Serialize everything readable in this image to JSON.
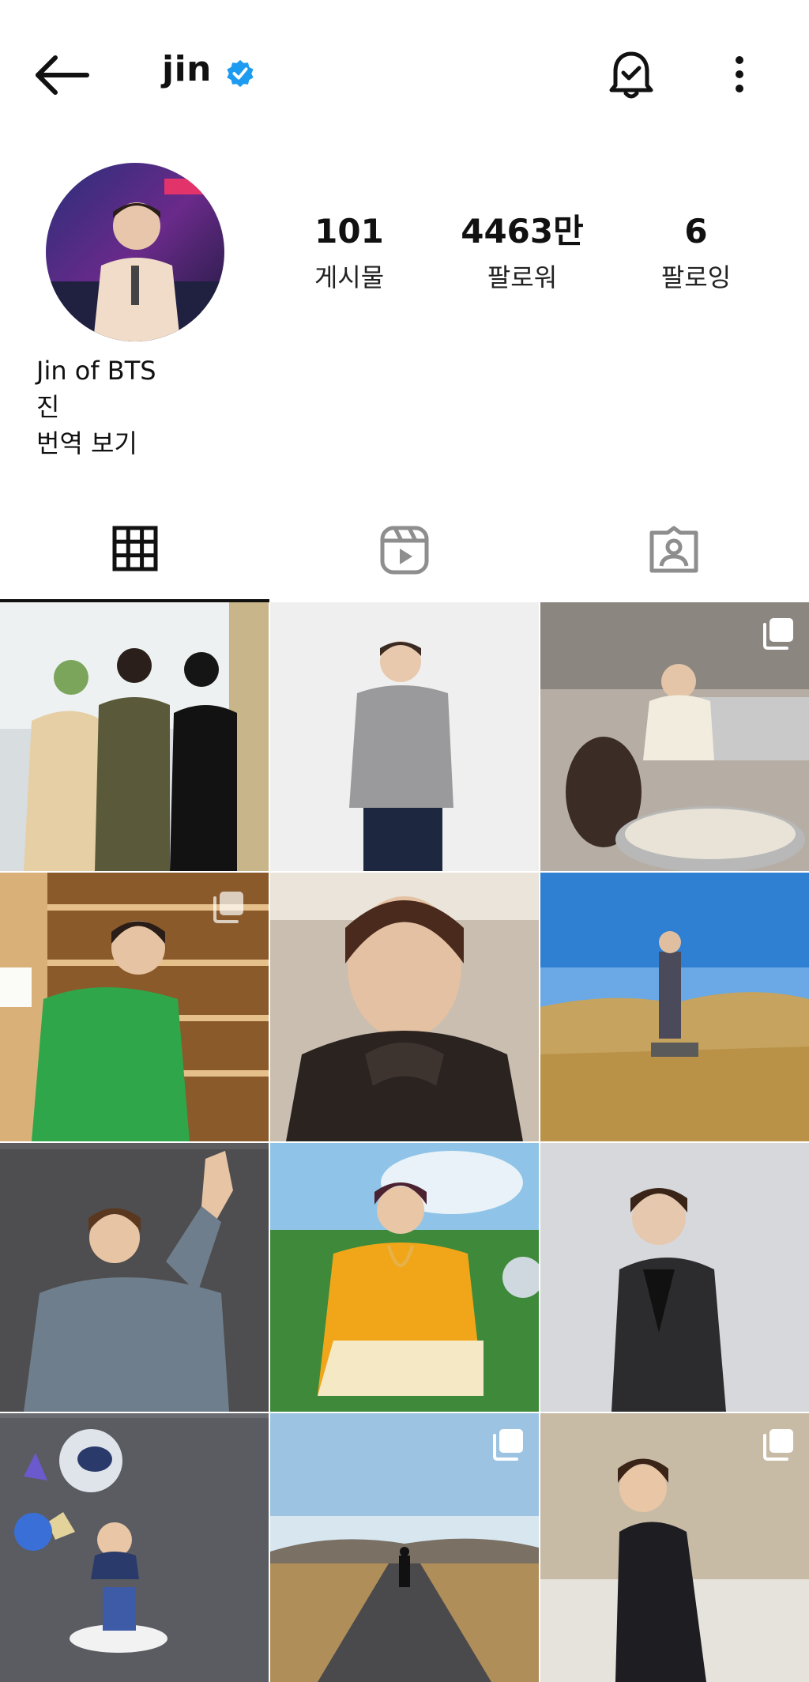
{
  "header": {
    "username": "jin",
    "back_icon": "arrow-left-icon",
    "verified_icon": "verified-badge-icon",
    "notification_icon": "bell-check-icon",
    "more_icon": "more-vertical-icon"
  },
  "profile": {
    "stats": [
      {
        "value": "101",
        "label": "게시물"
      },
      {
        "value": "4463만",
        "label": "팔로워"
      },
      {
        "value": "6",
        "label": "팔로잉"
      }
    ],
    "bio_name": "Jin of BTS",
    "bio_text": "진",
    "translate_link": "번역 보기"
  },
  "tabs": [
    {
      "icon": "grid-icon",
      "active": true
    },
    {
      "icon": "reels-icon",
      "active": false
    },
    {
      "icon": "tagged-icon",
      "active": false
    }
  ],
  "posts": [
    {
      "subject": "three-people-photo",
      "multi": false
    },
    {
      "subject": "gray-sweater-portrait",
      "multi": false
    },
    {
      "subject": "kitchen-rice-photo",
      "multi": true
    },
    {
      "subject": "green-sweater-wine-shop",
      "multi": true
    },
    {
      "subject": "leather-jacket-selfie",
      "multi": false
    },
    {
      "subject": "field-landscape-photo",
      "multi": false
    },
    {
      "subject": "denim-jacket-pose",
      "multi": false
    },
    {
      "subject": "yellow-sweater-garden",
      "multi": false
    },
    {
      "subject": "black-suit-portrait",
      "multi": false
    },
    {
      "subject": "astronaut-balloons-cake",
      "multi": false
    },
    {
      "subject": "desert-road-walk",
      "multi": true
    },
    {
      "subject": "black-suit-wall",
      "multi": true
    }
  ],
  "colors": {
    "verified_blue": "#1d9bf0",
    "text": "#111111",
    "icon_gray": "#8e8e8e"
  }
}
